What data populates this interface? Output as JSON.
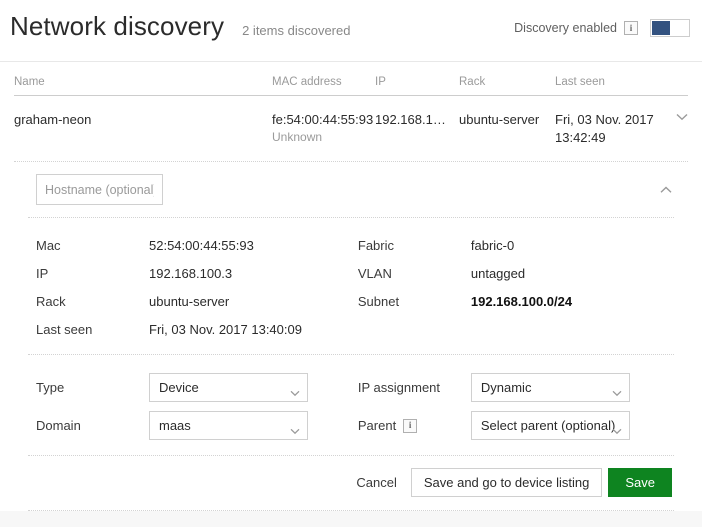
{
  "header": {
    "title": "Network discovery",
    "items_count": "2 items discovered",
    "discovery_label": "Discovery enabled",
    "info_glyph": "i",
    "toggle_state": "on",
    "toggle_on_color": "#335280"
  },
  "table": {
    "columns": [
      {
        "key": "name",
        "label": "Name"
      },
      {
        "key": "mac",
        "label": "MAC address"
      },
      {
        "key": "ip",
        "label": "IP"
      },
      {
        "key": "rack",
        "label": "Rack"
      },
      {
        "key": "last_seen",
        "label": "Last seen"
      }
    ],
    "rows": [
      {
        "name": "graham-neon",
        "mac": "fe:54:00:44:55:93",
        "mac_sub": "Unknown",
        "ip": "192.168.1…",
        "rack": "ubuntu-server",
        "last_seen": "Fri, 03 Nov. 2017 13:42:49"
      }
    ]
  },
  "panel": {
    "hostname": {
      "value": "",
      "placeholder": "Hostname (optional)"
    },
    "details_left": [
      {
        "label": "Mac",
        "value": "52:54:00:44:55:93"
      },
      {
        "label": "IP",
        "value": "192.168.100.3"
      },
      {
        "label": "Rack",
        "value": "ubuntu-server"
      },
      {
        "label": "Last seen",
        "value": "Fri, 03 Nov. 2017 13:40:09"
      }
    ],
    "details_right": [
      {
        "label": "Fabric",
        "value": "fabric-0"
      },
      {
        "label": "VLAN",
        "value": "untagged"
      },
      {
        "label": "Subnet",
        "value": "192.168.100.0/24"
      }
    ],
    "form_left": [
      {
        "label": "Type",
        "value": "Device"
      },
      {
        "label": "Domain",
        "value": "maas"
      }
    ],
    "form_right": [
      {
        "label": "IP assignment",
        "value": "Dynamic",
        "info": false
      },
      {
        "label": "Parent",
        "value": "Select parent (optional)",
        "info": true
      }
    ],
    "actions": {
      "cancel": "Cancel",
      "save_and_list": "Save and go to device listing",
      "save": "Save",
      "save_color": "#0e8420"
    }
  }
}
